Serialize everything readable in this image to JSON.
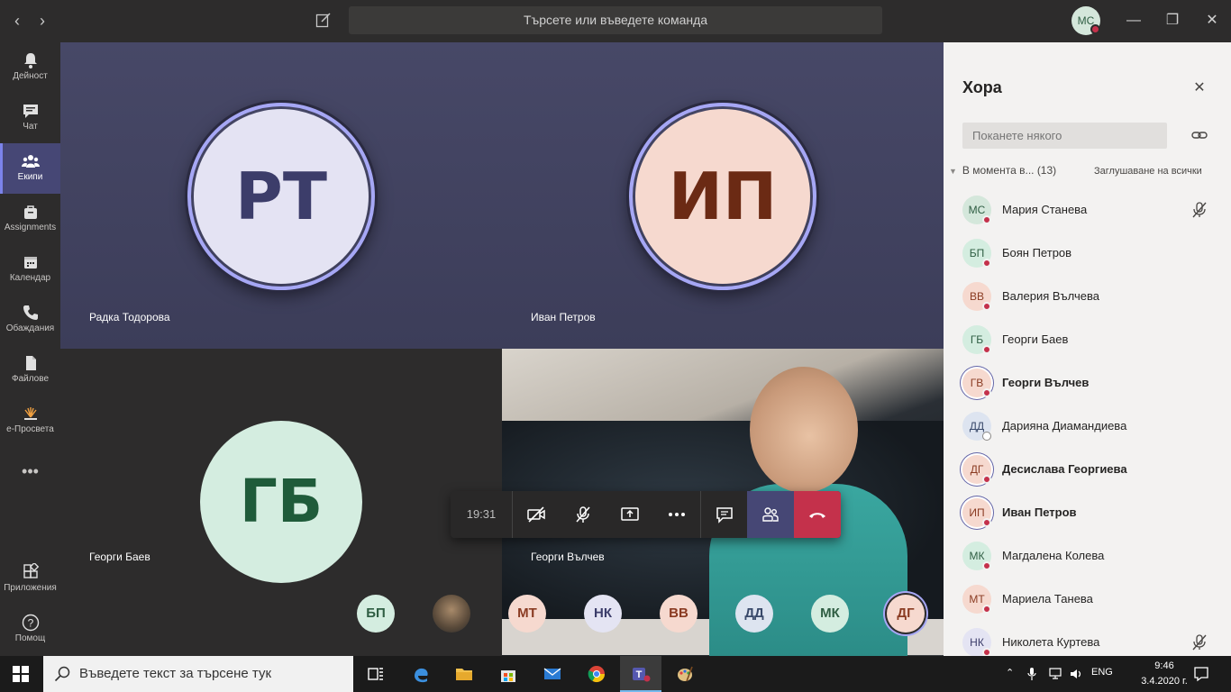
{
  "titlebar": {
    "search_placeholder": "Търсете или въведете команда",
    "user_initials": "МС"
  },
  "rail": {
    "items": [
      {
        "label": "Дейност",
        "icon": "bell-icon"
      },
      {
        "label": "Чат",
        "icon": "chat-icon"
      },
      {
        "label": "Екипи",
        "icon": "teams-icon"
      },
      {
        "label": "Assignments",
        "icon": "assignments-icon"
      },
      {
        "label": "Календар",
        "icon": "calendar-icon"
      },
      {
        "label": "Обаждания",
        "icon": "phone-icon"
      },
      {
        "label": "Файлове",
        "icon": "file-icon"
      },
      {
        "label": "е-Просвета",
        "icon": "eprosveta-icon"
      },
      {
        "label": "Приложения",
        "icon": "apps-icon"
      },
      {
        "label": "Помощ",
        "icon": "help-icon"
      }
    ],
    "more_label": "•••"
  },
  "stage": {
    "tiles": [
      {
        "initials": "РТ",
        "name": "Радка Тодорова"
      },
      {
        "initials": "ИП",
        "name": "Иван Петров"
      },
      {
        "initials": "ГБ",
        "name": "Георги Баев"
      },
      {
        "name": "Георги Вълчев"
      }
    ],
    "roster": [
      "БП",
      "",
      "МТ",
      "НК",
      "ВВ",
      "ДД",
      "МК",
      "ДГ"
    ]
  },
  "callbar": {
    "timer": "19:31"
  },
  "panel": {
    "title": "Хора",
    "invite_placeholder": "Поканете някого",
    "section_label": "В момента в... (13)",
    "mute_all": "Заглушаване на всички",
    "people": [
      {
        "initials": "МС",
        "name": "Мария Станева",
        "bold": false,
        "muted": true,
        "bg": "#d4e7db",
        "fg": "#2f5e43"
      },
      {
        "initials": "БП",
        "name": "Боян Петров",
        "bold": false,
        "muted": false,
        "bg": "#d4ede0",
        "fg": "#2f5e43"
      },
      {
        "initials": "ВВ",
        "name": "Валерия Вълчева",
        "bold": false,
        "muted": false,
        "bg": "#f6d9cf",
        "fg": "#8a3b22"
      },
      {
        "initials": "ГБ",
        "name": "Георги Баев",
        "bold": false,
        "muted": false,
        "bg": "#d4ede0",
        "fg": "#2f5e43"
      },
      {
        "initials": "ГВ",
        "name": "Георги Вълчев",
        "bold": true,
        "muted": false,
        "bg": "#f6d9cf",
        "fg": "#8a3b22"
      },
      {
        "initials": "ДД",
        "name": "Дарияна Диамандиева",
        "bold": false,
        "muted": false,
        "bg": "#dde4f0",
        "fg": "#3a4a6b"
      },
      {
        "initials": "ДГ",
        "name": "Десислава Георгиева",
        "bold": true,
        "muted": false,
        "bg": "#f6d9cf",
        "fg": "#8a3b22"
      },
      {
        "initials": "ИП",
        "name": "Иван Петров",
        "bold": true,
        "muted": false,
        "bg": "#f6d9cf",
        "fg": "#8a3b22"
      },
      {
        "initials": "МК",
        "name": "Магдалена Колева",
        "bold": false,
        "muted": false,
        "bg": "#d4ede0",
        "fg": "#2f5e43"
      },
      {
        "initials": "МТ",
        "name": "Мариела Танева",
        "bold": false,
        "muted": false,
        "bg": "#f6d9cf",
        "fg": "#8a3b22"
      },
      {
        "initials": "НК",
        "name": "Николета Куртева",
        "bold": false,
        "muted": true,
        "bg": "#e4e4f3",
        "fg": "#3c3d6a"
      }
    ]
  },
  "taskbar": {
    "search_placeholder": "Въведете текст за търсене тук",
    "language": "ENG",
    "time": "9:46",
    "date": "3.4.2020 г."
  },
  "colors": {
    "accent": "#6264a7",
    "hangup": "#c4314b"
  }
}
